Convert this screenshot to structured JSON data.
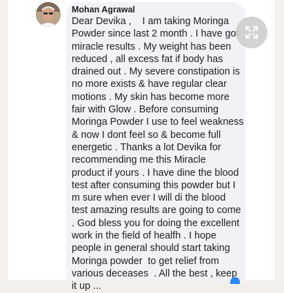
{
  "comment": {
    "author": "Mohan Agrawal",
    "lines": [
      "Dear Devika ,    I am taking Moringa",
      "Powder since last 2 month . I have got",
      "miracle results . My weight has been",
      "reduced , all excess fat if body has",
      "drained out . My severe constipation is",
      "no more exists & have regular clear",
      "motions . My skin has become more",
      "fair with Glow . Before consuming",
      "Moringa Powder I use to feel weakness",
      "& now I dont feel so & become full",
      "energetic . Thanks a lot Devika for",
      "recommending me this Miracle",
      "product if yours . I have dine the blood",
      "test after consuming this powder but I",
      "m sure when ever I will di the blood",
      "test amazing results are going to come",
      ". God bless you for doing the excellent",
      "work in the field of healfh . I hope",
      "people in general should start taking",
      "Moringa powder  to get relief from",
      "various deceases  . All the best , keep",
      "it up ..."
    ]
  },
  "icons": {
    "expand": "expand-arrows-icon",
    "avatar": "profile-photo"
  },
  "colors": {
    "bubble": "#f0f2f5",
    "text": "#1c1e21",
    "accent": "#2d88ff"
  }
}
